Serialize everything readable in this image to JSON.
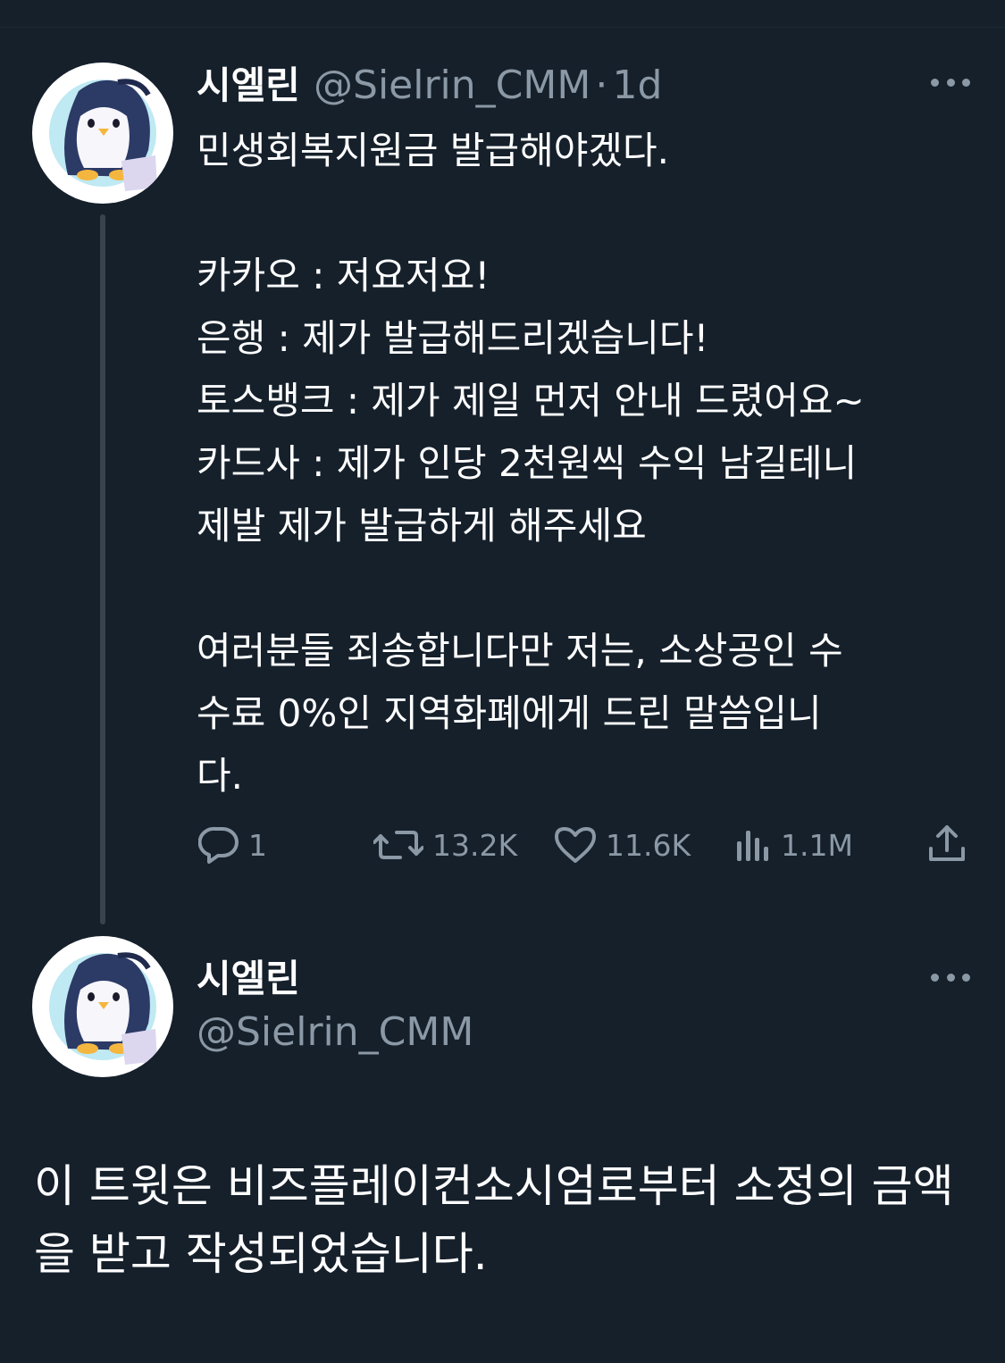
{
  "tweet": {
    "display_name": "시엘린",
    "handle": "@Sielrin_CMM",
    "separator": "·",
    "time": "1d",
    "text": "민생회복지원금 발급해야겠다.\n\n카카오 : 저요저요!\n은행 : 제가 발급해드리겠습니다!\n토스뱅크 : 제가 제일 먼저 안내 드렸어요~\n카드사 : 제가 인당 2천원씩 수익 남길테니\n제발 제가 발급하게 해주세요\n\n여러분들 죄송합니다만 저는, 소상공인 수\n수료 0%인 지역화폐에게 드린 말씀입니\n다.",
    "stats": {
      "replies": "1",
      "retweets": "13.2K",
      "likes": "11.6K",
      "views": "1.1M"
    }
  },
  "reply": {
    "display_name": "시엘린",
    "handle": "@Sielrin_CMM",
    "text": "이 트윗은 비즈플레이컨소시엄로부터 소정의 금액을 받고 작성되었습니다."
  },
  "icons": {
    "reply": "speech-bubble-icon",
    "retweet": "retweet-icon",
    "like": "heart-icon",
    "views": "bar-chart-icon",
    "share": "share-icon",
    "more": "more-dots-icon"
  },
  "colors": {
    "background": "#15202b",
    "text": "#ffffff",
    "muted": "#8b98a5",
    "thread_line": "#38444d"
  }
}
